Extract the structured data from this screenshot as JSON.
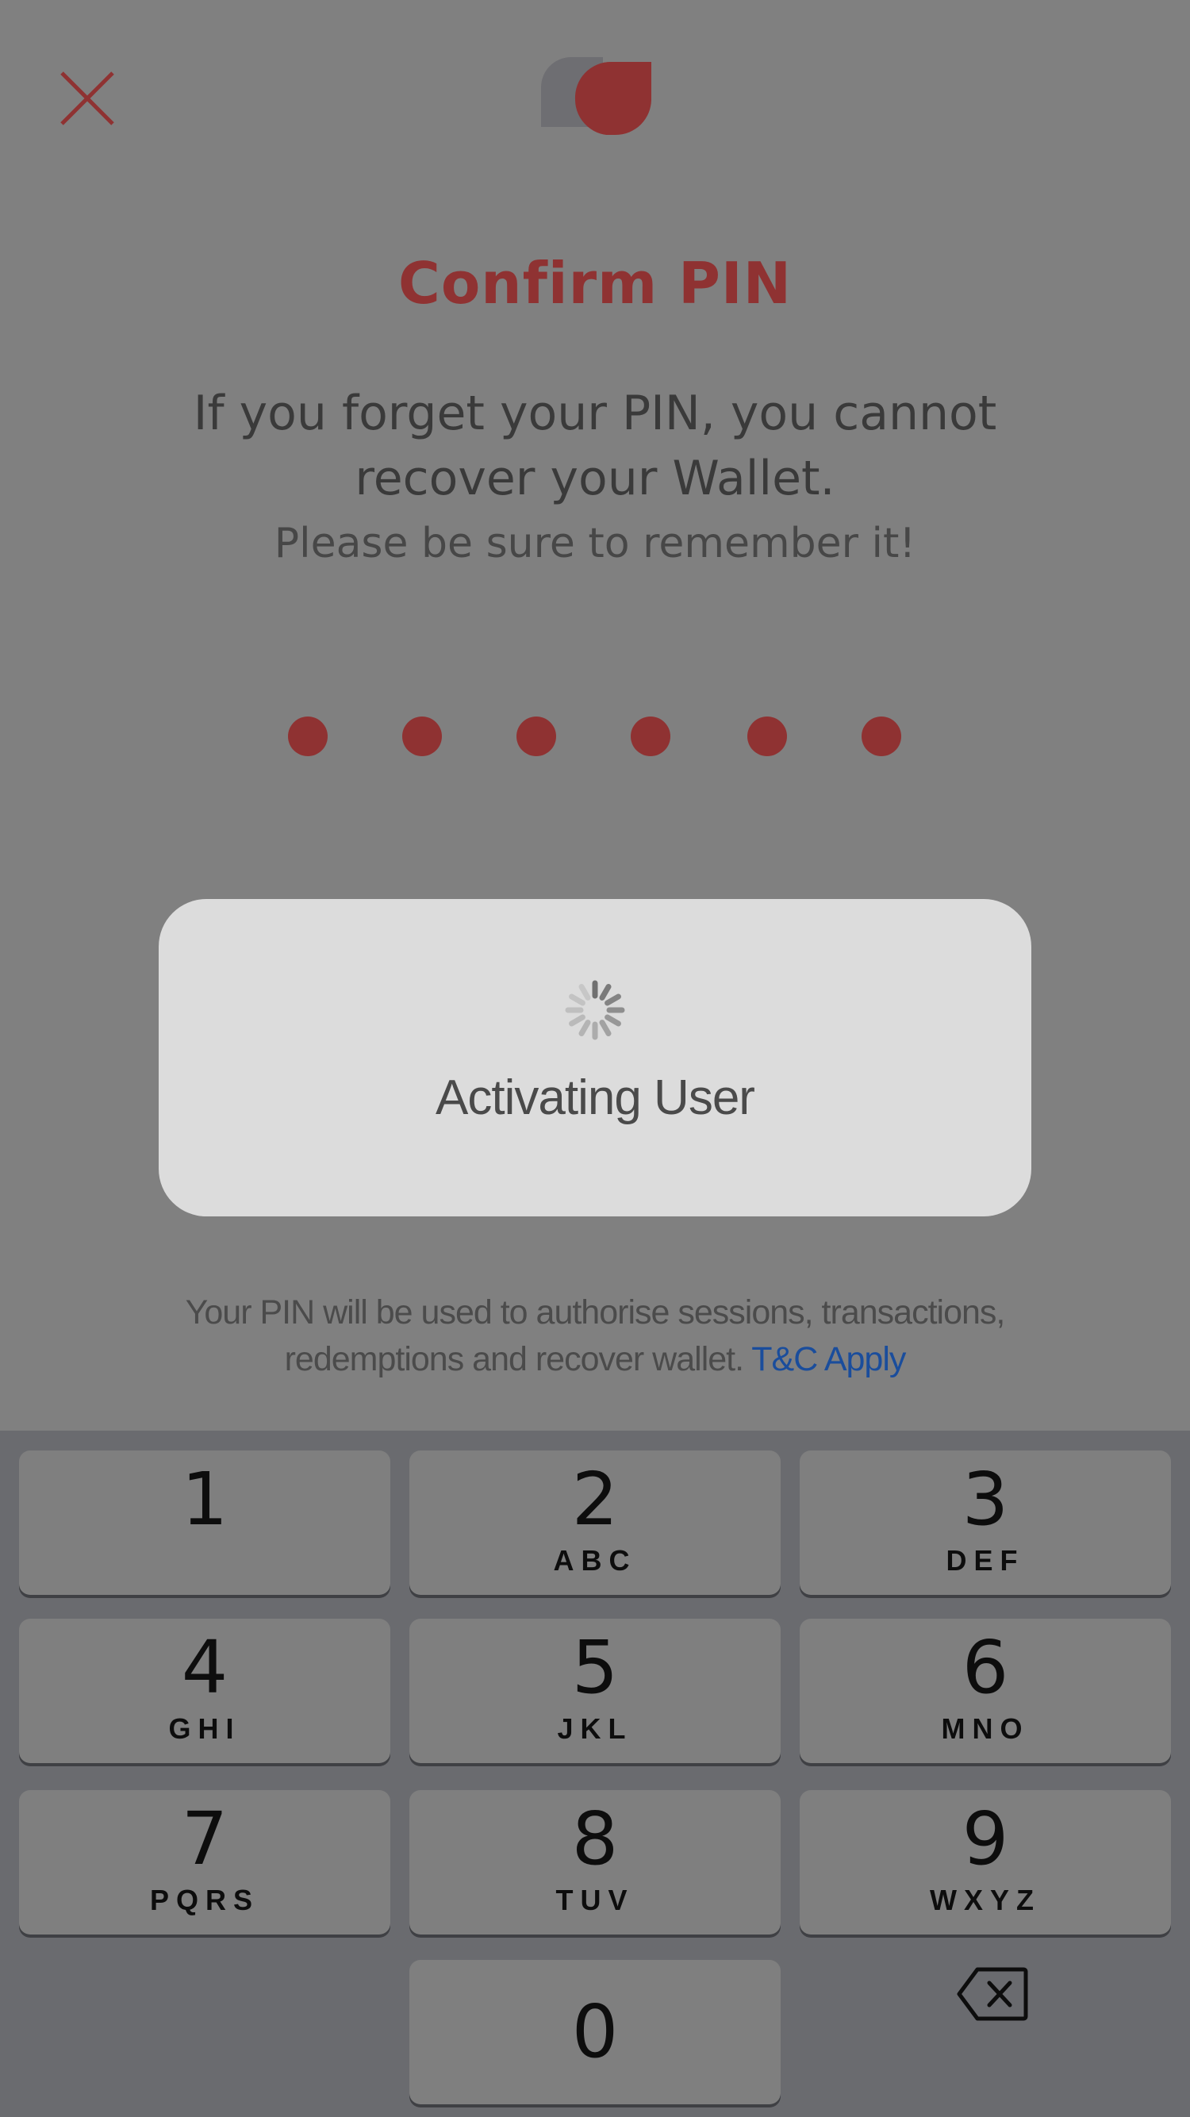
{
  "header": {
    "close_icon": "close-icon",
    "logo_icon": "app-logo-icon"
  },
  "title": "Confirm PIN",
  "warning": {
    "line1": "If you forget your PIN, you cannot",
    "line2": "recover your Wallet.",
    "reminder": "Please be sure to remember it!"
  },
  "pin": {
    "length": 6,
    "filled": 6
  },
  "dialog": {
    "spinner_icon": "spinner-icon",
    "text": "Activating User"
  },
  "info": {
    "text": "Your PIN will be used to authorise sessions, transactions, redemptions and recover wallet.",
    "link": "T&C Apply"
  },
  "keypad": {
    "keys": [
      {
        "digit": "1",
        "letters": ""
      },
      {
        "digit": "2",
        "letters": "ABC"
      },
      {
        "digit": "3",
        "letters": "DEF"
      },
      {
        "digit": "4",
        "letters": "GHI"
      },
      {
        "digit": "5",
        "letters": "JKL"
      },
      {
        "digit": "6",
        "letters": "MNO"
      },
      {
        "digit": "7",
        "letters": "PQRS"
      },
      {
        "digit": "8",
        "letters": "TUV"
      },
      {
        "digit": "9",
        "letters": "WXYZ"
      },
      {
        "digit": "0",
        "letters": ""
      }
    ],
    "backspace_icon": "backspace-icon"
  },
  "colors": {
    "accent": "#8f3232",
    "link": "#1a4d9c",
    "overlay_background": "#808080",
    "dialog_background": "#dcdcdc",
    "keypad_background": "#6a6b6f"
  }
}
